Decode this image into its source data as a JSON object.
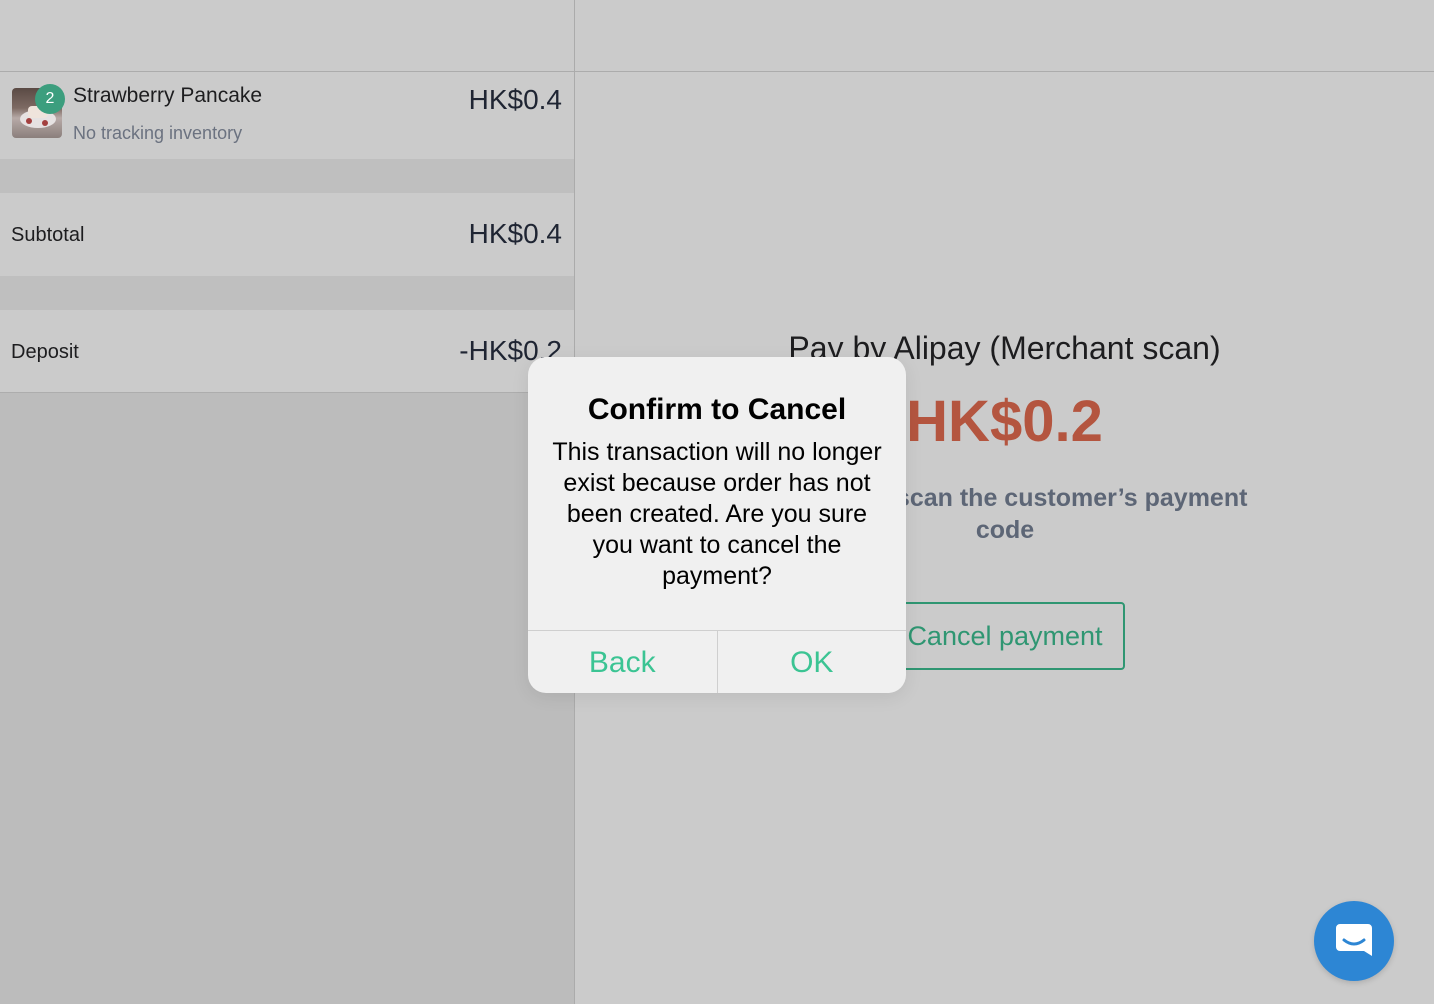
{
  "colors": {
    "accent": "#3bc493",
    "amount": "#b4553f",
    "badge": "#3c9e7e",
    "fab": "#2d86d4"
  },
  "cart": {
    "items": [
      {
        "quantity": "2",
        "name": "Strawberry Pancake",
        "note": "No tracking inventory",
        "price": "HK$0.4"
      }
    ],
    "subtotal_label": "Subtotal",
    "subtotal_value": "HK$0.4",
    "deposit_label": "Deposit",
    "deposit_value": "-HK$0.2"
  },
  "payment": {
    "title": "Pay by Alipay (Merchant scan)",
    "amount": "HK$0.2",
    "instruction": "scanner to scan the customer’s payment code",
    "cancel_label": "Cancel payment"
  },
  "modal": {
    "title": "Confirm to Cancel",
    "message": "This transaction will no longer exist because order has not been created. Are you sure you want to cancel the payment?",
    "back_label": "Back",
    "ok_label": "OK"
  },
  "icons": {
    "chat": "chat-icon"
  }
}
